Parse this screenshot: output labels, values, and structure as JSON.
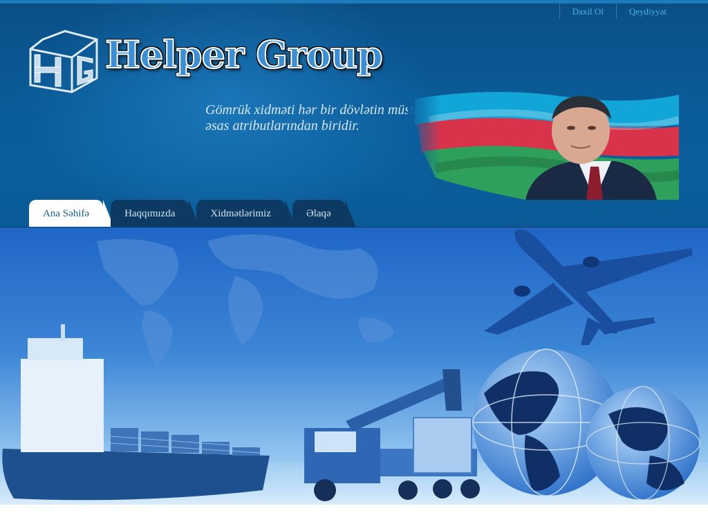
{
  "top_links": [
    {
      "label": "Daxil Ol"
    },
    {
      "label": "Qeydiyyat"
    }
  ],
  "logo": {
    "mark_letters": "HG",
    "text": "Helper Group"
  },
  "quote": {
    "line1": "Gömrük xidməti hər bir dövlətin müstəqilliyinin",
    "line2": "əsas atributlarından biridir."
  },
  "nav": {
    "tabs": [
      {
        "label": "Ana Səhifə",
        "active": true
      },
      {
        "label": "Haqqımızda",
        "active": false
      },
      {
        "label": "Xidmətlərimiz",
        "active": false
      },
      {
        "label": "Əlaqə",
        "active": false
      }
    ]
  },
  "colors": {
    "header_blue": "#0a5a96",
    "tab_dark": "#0d3a63",
    "link_blue": "#4fb0ea",
    "flag_blue": "#00b5e2",
    "flag_red": "#ef3340",
    "flag_green": "#509e2f"
  }
}
